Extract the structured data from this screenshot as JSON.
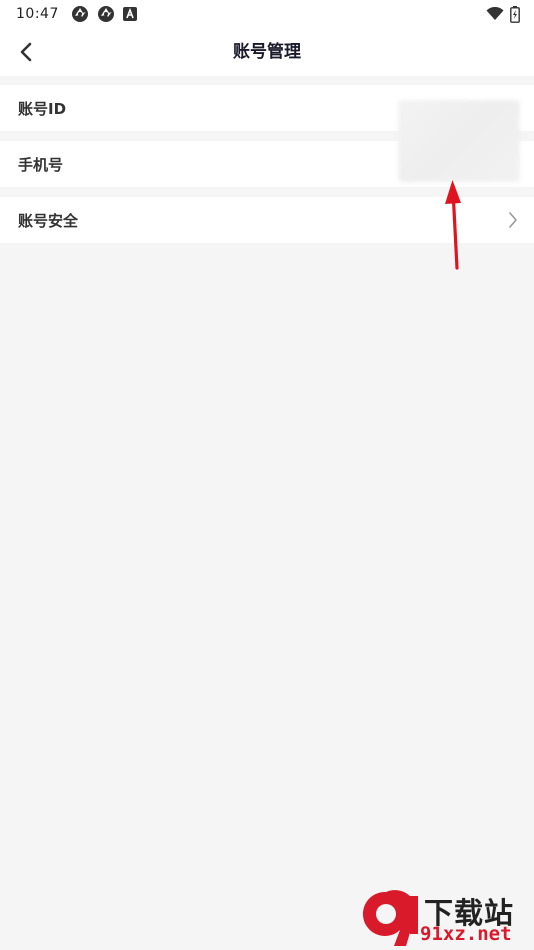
{
  "status_bar": {
    "time": "10:47",
    "left_icons": [
      "aperture-icon",
      "aperture-icon",
      "app-a-icon"
    ],
    "right_icons": [
      "wifi-icon",
      "battery-charging-icon"
    ]
  },
  "header": {
    "back_icon": "chevron-left-icon",
    "title": "账号管理"
  },
  "rows": [
    {
      "label": "账号ID",
      "value": ""
    },
    {
      "label": "手机号",
      "value": ""
    },
    {
      "label": "账号安全",
      "has_chevron": true
    }
  ],
  "annotation": {
    "arrow_color": "#e0141e"
  },
  "watermark": {
    "cn": "下载站",
    "en": "91xz.net",
    "logo_color": "#d81a2a"
  },
  "colors": {
    "background": "#f5f5f5",
    "card": "#ffffff",
    "title": "#1a1a2a"
  }
}
